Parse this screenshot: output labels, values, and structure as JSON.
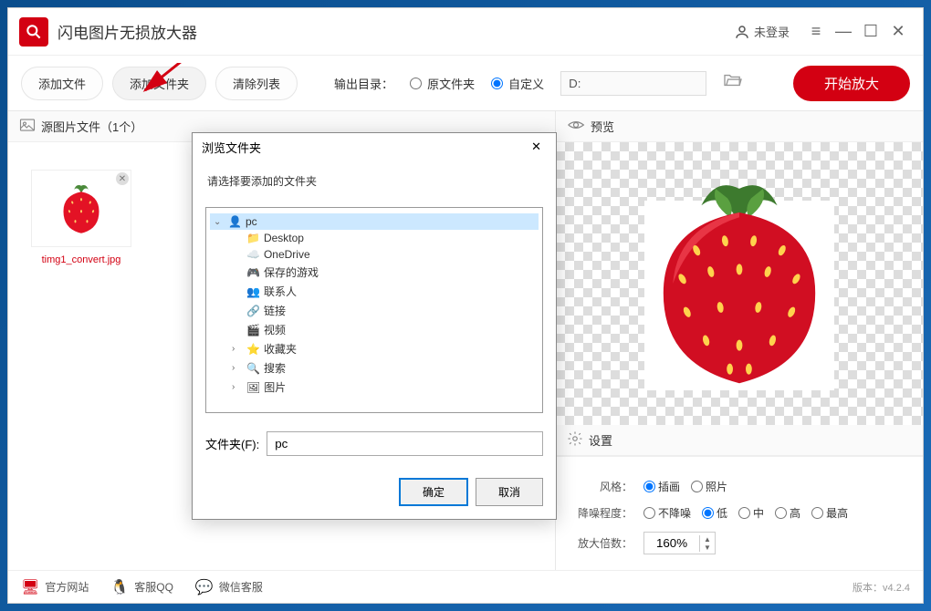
{
  "titlebar": {
    "app_name": "闪电图片无损放大器",
    "login_status": "未登录"
  },
  "toolbar": {
    "add_file": "添加文件",
    "add_folder": "添加文件夹",
    "clear_list": "清除列表",
    "output_label": "输出目录：",
    "radio_source": "原文件夹",
    "radio_custom": "自定义",
    "output_path": "D:",
    "start": "开始放大"
  },
  "left": {
    "header": "源图片文件（1个）",
    "thumbs": [
      {
        "filename": "timg1_convert.jpg"
      }
    ]
  },
  "right": {
    "preview_label": "预览",
    "settings_label": "设置",
    "style_label": "风格：",
    "style_illustration": "插画",
    "style_photo": "照片",
    "denoise_label": "降噪程度：",
    "denoise_none": "不降噪",
    "denoise_low": "低",
    "denoise_mid": "中",
    "denoise_high": "高",
    "denoise_max": "最高",
    "scale_label": "放大倍数：",
    "scale_value": "160%"
  },
  "footer": {
    "website": "官方网站",
    "qq": "客服QQ",
    "wechat": "微信客服",
    "version": "版本：v4.2.4"
  },
  "dialog": {
    "title": "浏览文件夹",
    "prompt": "请选择要添加的文件夹",
    "folder_label": "文件夹(F):",
    "folder_value": "pc",
    "ok": "确定",
    "cancel": "取消",
    "tree": [
      {
        "label": "pc",
        "level": 0,
        "expanded": true,
        "selected": true,
        "icon": "user"
      },
      {
        "label": "Desktop",
        "level": 1,
        "icon": "folder"
      },
      {
        "label": "OneDrive",
        "level": 1,
        "icon": "onedrive"
      },
      {
        "label": "保存的游戏",
        "level": 1,
        "icon": "games"
      },
      {
        "label": "联系人",
        "level": 1,
        "icon": "contacts"
      },
      {
        "label": "链接",
        "level": 1,
        "icon": "link"
      },
      {
        "label": "视频",
        "level": 1,
        "icon": "video"
      },
      {
        "label": "收藏夹",
        "level": 1,
        "expandable": true,
        "icon": "star"
      },
      {
        "label": "搜索",
        "level": 1,
        "expandable": true,
        "icon": "search"
      },
      {
        "label": "图片",
        "level": 1,
        "expandable": true,
        "icon": "picture"
      }
    ]
  }
}
